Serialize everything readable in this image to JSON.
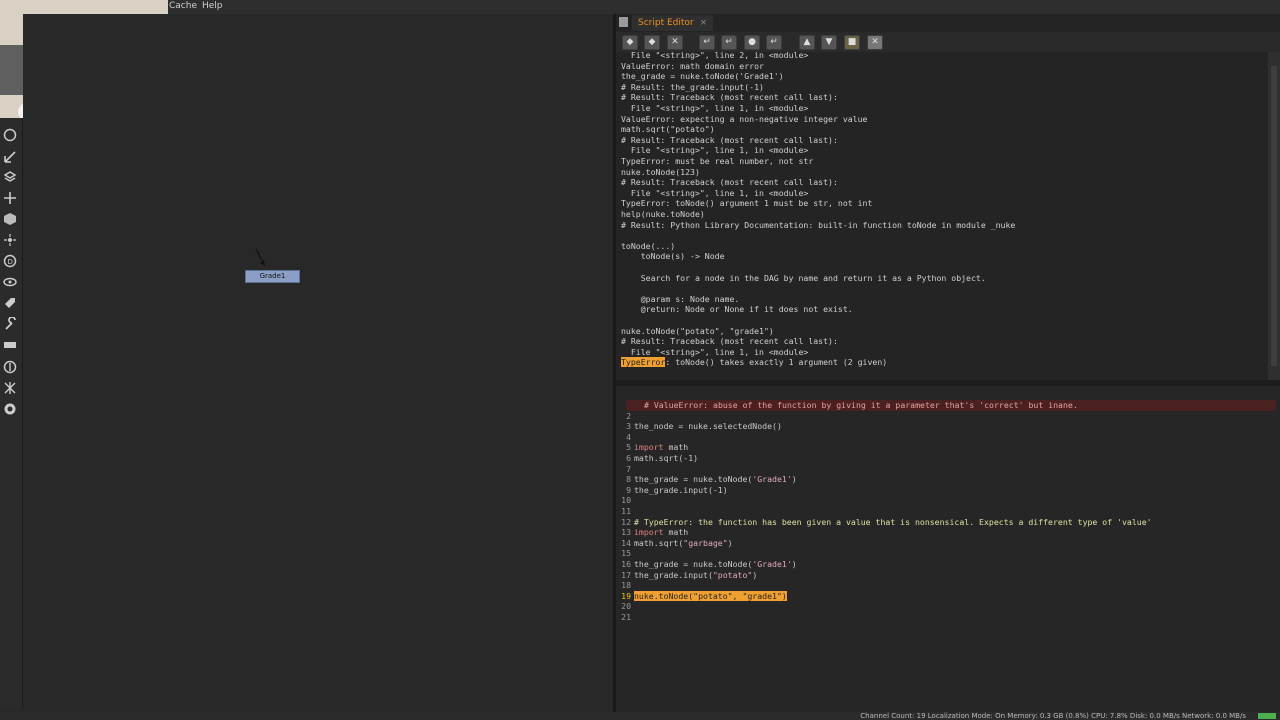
{
  "menu": [
    "Cache",
    "Help"
  ],
  "tab": {
    "label": "Script Editor",
    "close": "×"
  },
  "toolbar_buttons": [
    "prev-history",
    "next-history",
    "clear-history",
    "source-script",
    "load-script",
    "save-script",
    "run",
    "show-input-only",
    "show-output-only",
    "show-both",
    "clear-output"
  ],
  "node": {
    "label": "Grade1"
  },
  "output_lines": [
    "  File \"<string>\", line 2, in <module>",
    "ValueError: math domain error",
    "the_grade = nuke.toNode('Grade1')",
    "# Result: the_grade.input(-1)",
    "# Result: Traceback (most recent call last):",
    "  File \"<string>\", line 1, in <module>",
    "ValueError: expecting a non-negative integer value",
    "math.sqrt(\"potato\")",
    "# Result: Traceback (most recent call last):",
    "  File \"<string>\", line 1, in <module>",
    "TypeError: must be real number, not str",
    "nuke.toNode(123)",
    "# Result: Traceback (most recent call last):",
    "  File \"<string>\", line 1, in <module>",
    "TypeError: toNode() argument 1 must be str, not int",
    "help(nuke.toNode)",
    "# Result: Python Library Documentation: built-in function toNode in module _nuke",
    "",
    "toNode(...)",
    "    toNode(s) -> Node",
    "",
    "    Search for a node in the DAG by name and return it as a Python object.",
    "",
    "    @param s: Node name.",
    "    @return: Node or None if it does not exist.",
    "",
    "nuke.toNode(\"potato\", \"grade1\")",
    "# Result: Traceback (most recent call last):",
    "  File \"<string>\", line 1, in <module>"
  ],
  "last_error": {
    "type": "TypeError",
    "message": ": toNode() takes exactly 1 argument (2 given)"
  },
  "code_lines": [
    {
      "n": "",
      "text": "# ValueError: abuse of the function by giving it a parameter that's 'correct' but inane."
    },
    {
      "n": "2",
      "text": ""
    },
    {
      "n": "3",
      "text": "the_node = nuke.selectedNode()"
    },
    {
      "n": "4",
      "text": ""
    },
    {
      "n": "5",
      "kw": "import",
      "text": " math"
    },
    {
      "n": "6",
      "text": "math.sqrt(-1)"
    },
    {
      "n": "7",
      "text": ""
    },
    {
      "n": "8",
      "text": "the_grade = nuke.toNode(",
      "str": "'Grade1'",
      "tail": ")"
    },
    {
      "n": "9",
      "text": "the_grade.input(-1)"
    },
    {
      "n": "10",
      "text": ""
    },
    {
      "n": "11",
      "text": ""
    },
    {
      "n": "12",
      "comment": "# TypeError: the function has been given a value that is nonsensical. Expects a different type of 'value'"
    },
    {
      "n": "13",
      "kw": "import",
      "text": " math"
    },
    {
      "n": "14",
      "text": "math.sqrt(",
      "str": "\"garbage\"",
      "tail": ")"
    },
    {
      "n": "15",
      "text": ""
    },
    {
      "n": "16",
      "text": "the_grade = nuke.toNode(",
      "str": "'Grade1'",
      "tail": ")"
    },
    {
      "n": "17",
      "text": "the_grade.input(",
      "str": "\"potato\"",
      "tail": ")"
    },
    {
      "n": "18",
      "text": ""
    },
    {
      "n": "19",
      "highlight": "nuke.toNode(\"potato\", \"grade1\")"
    },
    {
      "n": "20",
      "text": ""
    },
    {
      "n": "21",
      "text": ""
    }
  ],
  "status": "Channel Count: 19  Localization Mode: On  Memory: 0.3 GB (0.8%)  CPU: 7.8%  Disk: 0.0 MB/s  Network: 0.0 MB/s"
}
